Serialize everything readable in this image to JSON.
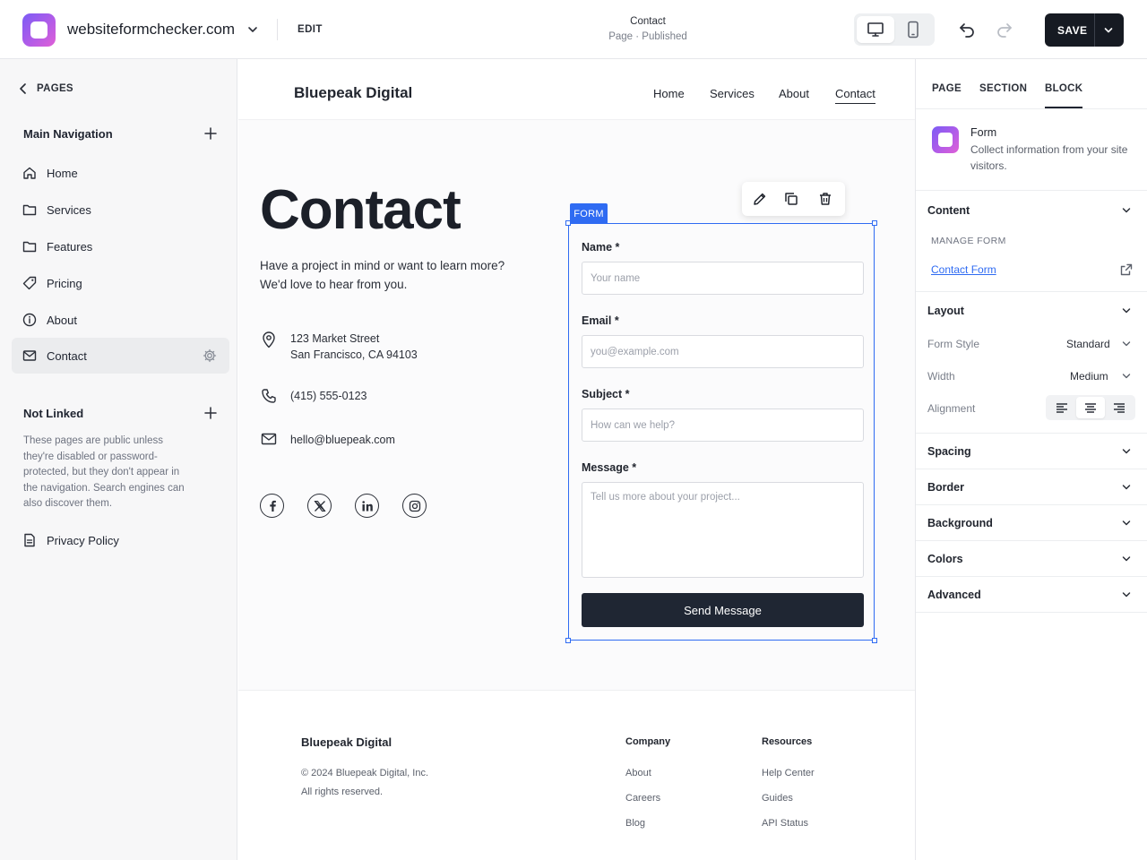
{
  "topbar": {
    "site_name": "websiteformchecker.com",
    "edit_label": "EDIT",
    "page_title": "Contact",
    "page_status": "Page · Published",
    "save_label": "SAVE"
  },
  "sidebar": {
    "back_label": "PAGES",
    "main_nav_title": "Main Navigation",
    "items": [
      {
        "label": "Home",
        "icon": "home-icon"
      },
      {
        "label": "Services",
        "icon": "folder-icon"
      },
      {
        "label": "Features",
        "icon": "folder-icon"
      },
      {
        "label": "Pricing",
        "icon": "tag-icon"
      },
      {
        "label": "About",
        "icon": "info-icon"
      },
      {
        "label": "Contact",
        "icon": "mail-icon",
        "active": true
      }
    ],
    "not_linked_title": "Not Linked",
    "not_linked_desc": "These pages are public unless they're disabled or password-protected, but they don't appear in the navigation. Search engines can also discover them.",
    "unlinked_items": [
      {
        "label": "Privacy Policy",
        "icon": "document-icon"
      }
    ]
  },
  "site": {
    "brand": "Bluepeak Digital",
    "nav": [
      "Home",
      "Services",
      "About",
      "Contact"
    ],
    "active_nav": "Contact",
    "hero_title": "Contact",
    "intro": "Have a project in mind or want to learn more? We'd love to hear from you.",
    "address_line1": "123 Market Street",
    "address_line2": "San Francisco, CA 94103",
    "phone": "(415) 555-0123",
    "email": "hello@bluepeak.com",
    "socials": [
      "facebook-icon",
      "x-icon",
      "linkedin-icon",
      "instagram-icon"
    ]
  },
  "form": {
    "tag": "FORM",
    "name_label": "Name *",
    "name_placeholder": "Your name",
    "email_label": "Email *",
    "email_placeholder": "you@example.com",
    "subject_label": "Subject *",
    "subject_placeholder": "How can we help?",
    "message_label": "Message *",
    "message_placeholder": "Tell us more about your project...",
    "submit_label": "Send Message"
  },
  "footer": {
    "brand": "Bluepeak Digital",
    "copyright": "© 2024 Bluepeak Digital, Inc.",
    "rights": "All rights reserved.",
    "company_title": "Company",
    "company_links": [
      "About",
      "Careers",
      "Blog"
    ],
    "resources_title": "Resources",
    "resources_links": [
      "Help Center",
      "Guides",
      "API Status"
    ]
  },
  "inspector": {
    "tabs": [
      "PAGE",
      "SECTION",
      "BLOCK"
    ],
    "active_tab": "BLOCK",
    "block_name": "Form",
    "block_desc": "Collect information from your site visitors.",
    "content_title": "Content",
    "manage_form_label": "MANAGE FORM",
    "form_link": "Contact Form",
    "layout_title": "Layout",
    "form_style_label": "Form Style",
    "form_style_value": "Standard",
    "width_label": "Width",
    "width_value": "Medium",
    "alignment_label": "Alignment",
    "alignment_value": "center",
    "sections": [
      "Spacing",
      "Border",
      "Background",
      "Colors",
      "Advanced"
    ]
  },
  "colors": {
    "accent": "#2f6bf2",
    "primary_button": "#1f2633",
    "save_button": "#161a22"
  }
}
